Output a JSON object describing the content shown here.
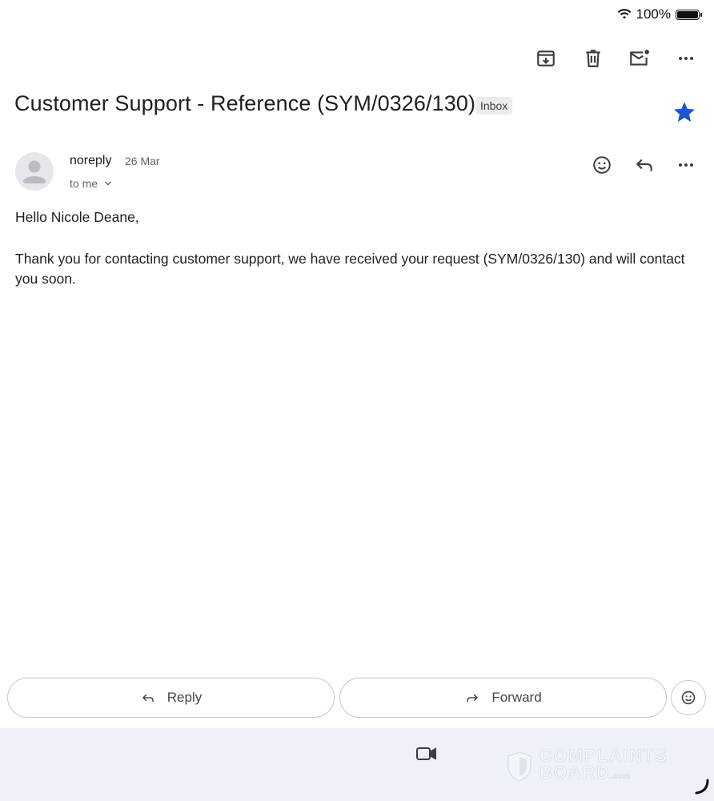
{
  "status_bar": {
    "battery_text": "100%",
    "icons": [
      "wifi-icon",
      "battery-icon"
    ]
  },
  "toolbar": {
    "icons": [
      "archive-icon",
      "delete-icon",
      "mark-unread-icon",
      "more-icon"
    ]
  },
  "email": {
    "subject": "Customer Support - Reference (SYM/0326/130)",
    "label": "Inbox",
    "starred": true,
    "sender": {
      "name": "noreply",
      "date": "26 Mar",
      "recipient": "to me"
    },
    "greeting": "Hello Nicole Deane,",
    "body": "Thank you for contacting customer support, we have received your request (SYM/0326/130) and will contact you soon."
  },
  "actions": {
    "reply_label": "Reply",
    "forward_label": "Forward"
  },
  "watermark": {
    "line1": "COMPLAINTS",
    "line2": "BOARD",
    "line2_suffix": ".com"
  },
  "colors": {
    "star": "#1a57d1",
    "bottom_bar": "#eef2f8",
    "text": "#1f1f1f",
    "secondary_text": "#5f6368"
  }
}
